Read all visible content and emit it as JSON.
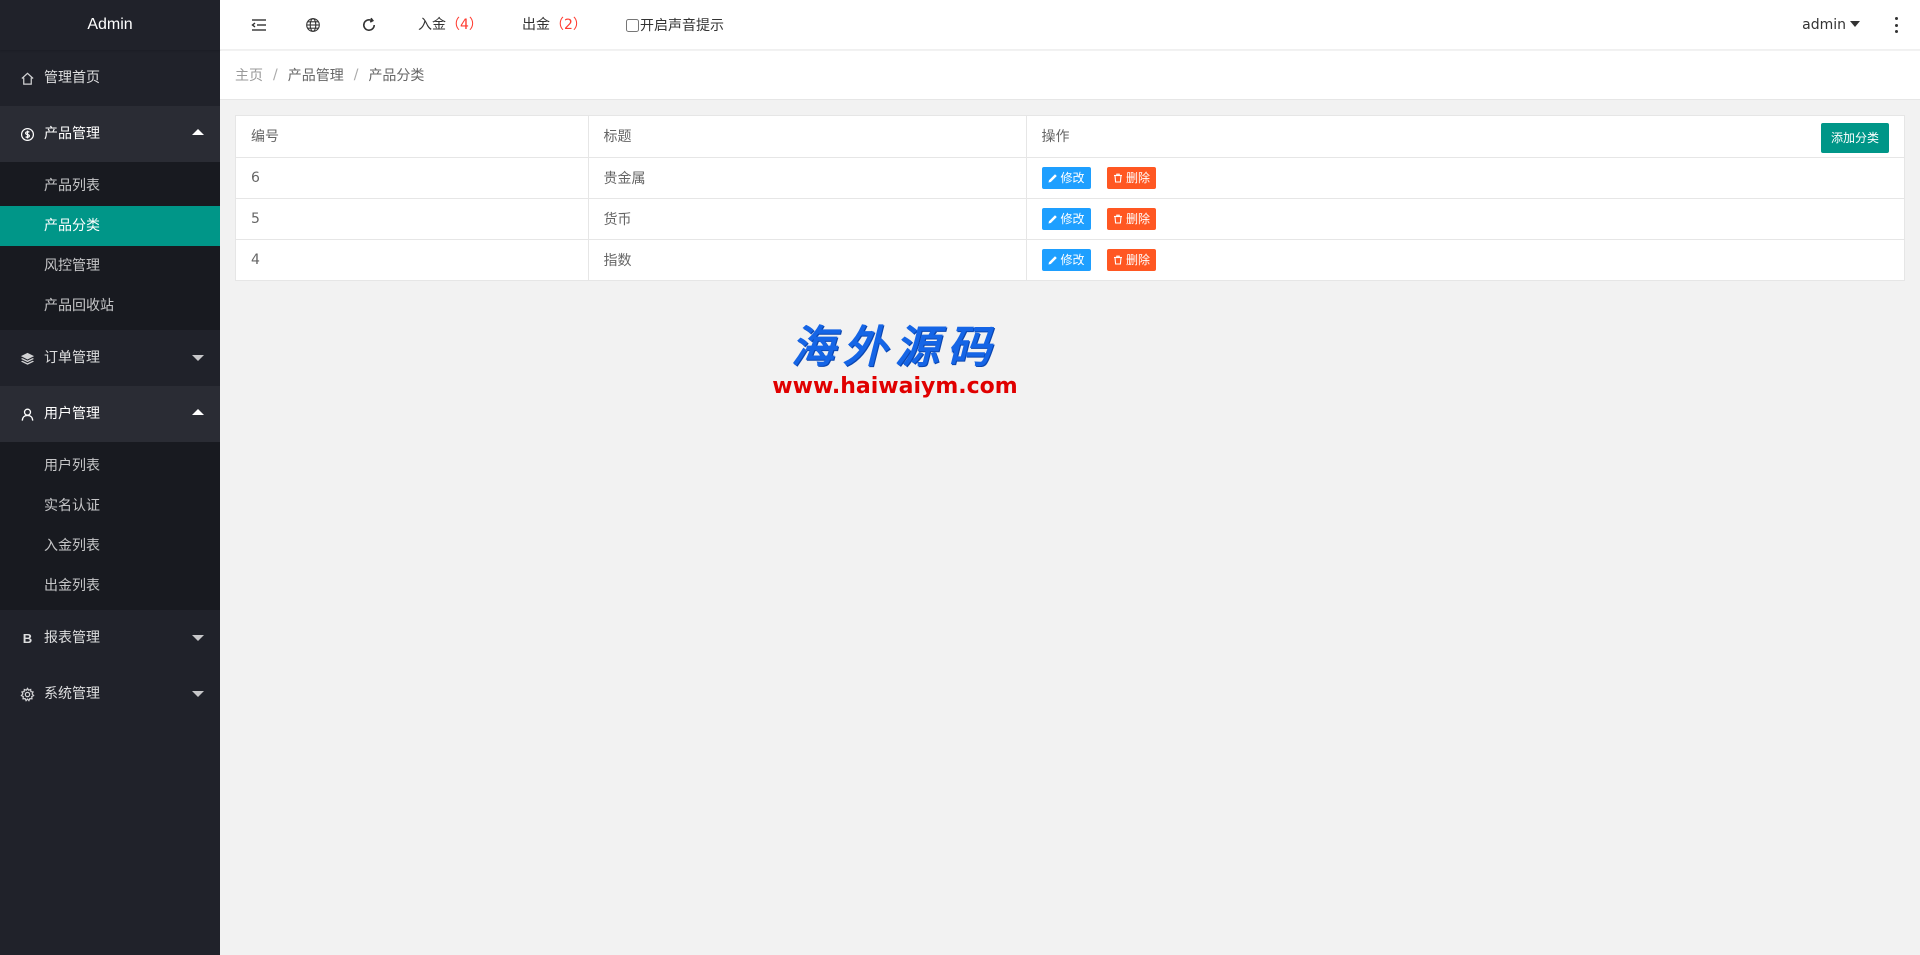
{
  "sidebar": {
    "logo": "Admin",
    "menus": [
      {
        "label": "管理首页",
        "icon": "home-icon"
      },
      {
        "label": "产品管理",
        "icon": "dollar-circle-icon",
        "open": true,
        "children": [
          "产品列表",
          "产品分类",
          "风控管理",
          "产品回收站"
        ],
        "active": "产品分类"
      },
      {
        "label": "订单管理",
        "icon": "layers-icon"
      },
      {
        "label": "用户管理",
        "icon": "user-icon",
        "open": true,
        "children": [
          "用户列表",
          "实名认证",
          "入金列表",
          "出金列表"
        ]
      },
      {
        "label": "报表管理",
        "icon": "bold-b-icon"
      },
      {
        "label": "系统管理",
        "icon": "gear-icon"
      }
    ]
  },
  "header": {
    "deposit_label": "入金",
    "deposit_open": "（",
    "deposit_count": "4",
    "deposit_close": "）",
    "withdraw_label": "出金",
    "withdraw_open": "（",
    "withdraw_count": "2",
    "withdraw_close": "）",
    "sound_label": "开启声音提示",
    "user": "admin"
  },
  "breadcrumb": [
    "主页",
    "产品管理",
    "产品分类"
  ],
  "table": {
    "columns": [
      "编号",
      "标题",
      "操作"
    ],
    "add_button": "添加分类",
    "edit_label": "修改",
    "delete_label": "删除",
    "rows": [
      {
        "id": "6",
        "title": "贵金属"
      },
      {
        "id": "5",
        "title": "货币"
      },
      {
        "id": "4",
        "title": "指数"
      }
    ]
  },
  "watermark": {
    "title": "海外源码",
    "url": "www.haiwaiym.com"
  }
}
